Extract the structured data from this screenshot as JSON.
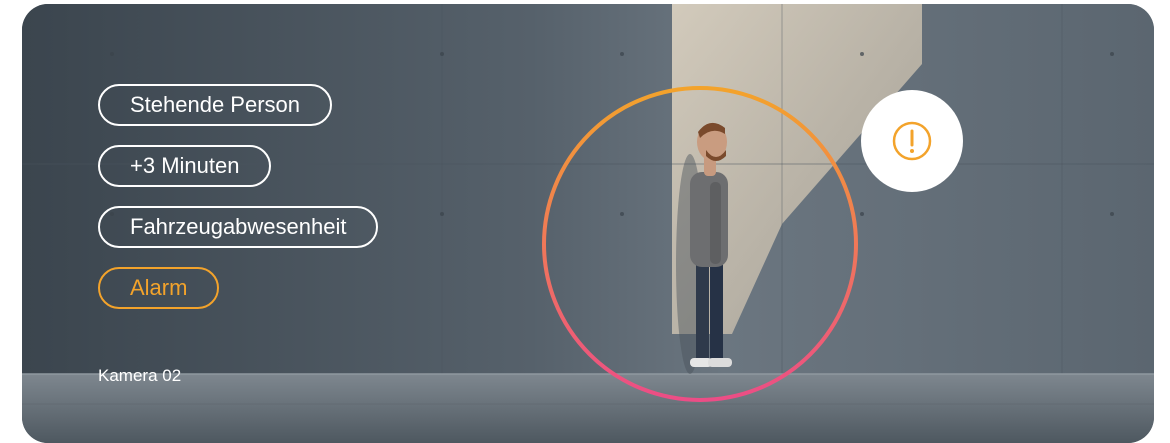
{
  "labels": {
    "standing_person": "Stehende Person",
    "duration": "+3 Minuten",
    "vehicle_absence": "Fahrzeugabwesenheit",
    "alarm": "Alarm"
  },
  "camera": {
    "name": "Kamera 02"
  },
  "icons": {
    "alert": "exclamation-circle-icon",
    "detection_ring": "detection-ring"
  },
  "colors": {
    "alarm": "#f3a32b",
    "ring_top": "#f3a32b",
    "ring_bottom": "#ec4d86",
    "chip_border": "#ffffff"
  }
}
